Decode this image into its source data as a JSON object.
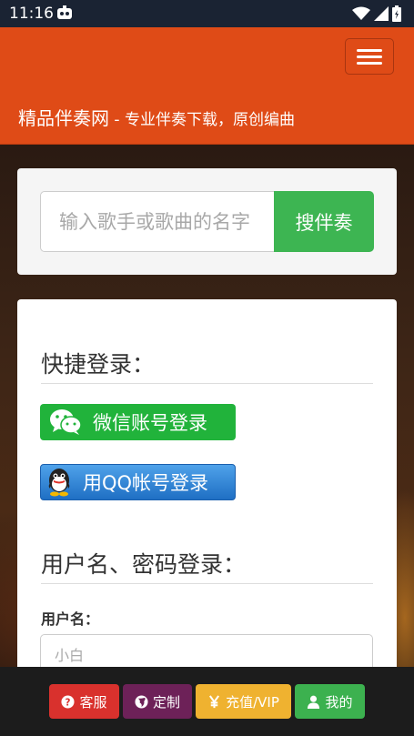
{
  "status_bar": {
    "time": "11:16"
  },
  "header": {
    "site_name": "精品伴奏网",
    "tagline": " - 专业伴奏下载，原创编曲"
  },
  "search": {
    "placeholder": "输入歌手或歌曲的名字",
    "button_label": "搜伴奏"
  },
  "login": {
    "quick_title": "快捷登录：",
    "wechat_label": "微信账号登录",
    "qq_label": "用QQ帐号登录",
    "password_title": "用户名、密码登录：",
    "username_label": "用户名：",
    "username_placeholder": "小白"
  },
  "bottom_bar": {
    "service": "客服",
    "custom": "定制",
    "recharge": "充值/VIP",
    "mine": "我的"
  },
  "colors": {
    "header": "#df4b17",
    "search_button": "#3db552",
    "service": "#d9312d",
    "custom": "#6d2158",
    "recharge": "#efb230",
    "mine": "#3cb14f"
  },
  "icons": [
    "notification-icon",
    "wifi-icon",
    "signal-icon",
    "battery-icon",
    "menu-icon",
    "wechat-icon",
    "qq-icon",
    "question-icon",
    "globe-icon",
    "yen-icon",
    "user-icon"
  ]
}
